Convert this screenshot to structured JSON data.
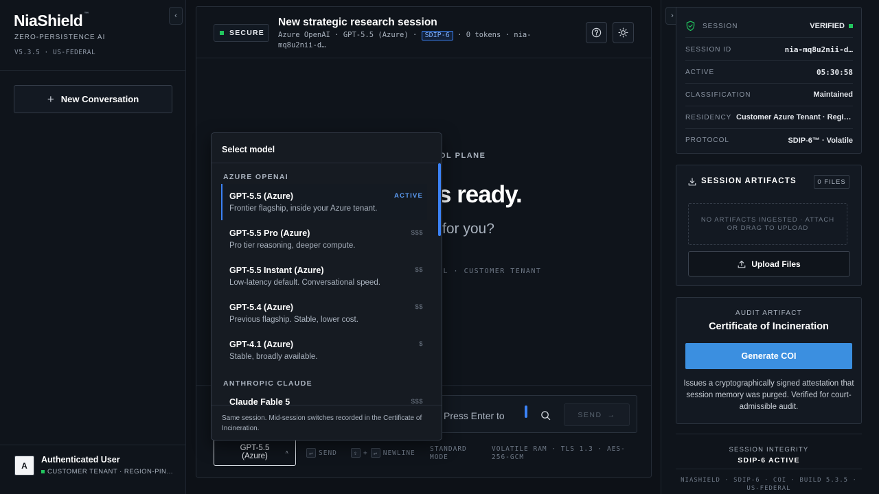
{
  "sidebar": {
    "brand": "NiaShield",
    "brand_mark": "™",
    "tagline": "ZERO-PERSISTENCE AI",
    "version": "V5.3.5 · US-FEDERAL",
    "collapse_glyph": "‹",
    "new_conversation": "New Conversation",
    "user": {
      "initial": "A",
      "name": "Authenticated User",
      "tenant": "CUSTOMER TENANT · REGION-PIN…"
    }
  },
  "header": {
    "secure_badge": "SECURE",
    "title": "New strategic research session",
    "meta_provider": "Azure OpenAI · GPT-5.5 (Azure) ·",
    "meta_tag": "SDIP-6",
    "meta_tokens": "· 0 tokens · nia-",
    "meta_session": "mq8u2nii-d…",
    "help_icon": "help-circle-icon",
    "theme_icon": "sun-icon"
  },
  "hero": {
    "kicker": "OL PLANE",
    "title": "s ready.",
    "subtitle": "for you?",
    "footer": "OL · CUSTOMER TENANT"
  },
  "composer": {
    "placeholder": "Press Enter to",
    "send_label": "SEND",
    "send_arrow": "→"
  },
  "footer_bar": {
    "model_line1": "GPT-5.5",
    "model_line2": "(Azure)",
    "model_chevron": "˄",
    "send_hint": "SEND",
    "plus": "+",
    "newline_hint": "NEWLINE",
    "mode_line1": "STANDARD",
    "mode_line2": "MODE",
    "encryption": "VOLATILE RAM · TLS 1.3 · AES-256-GCM"
  },
  "model_dropdown": {
    "title": "Select model",
    "groups": [
      {
        "label": "AZURE OPENAI"
      },
      {
        "label": "ANTHROPIC CLAUDE"
      }
    ],
    "options": [
      {
        "name": "GPT-5.5 (Azure)",
        "desc": "Frontier flagship, inside your Azure tenant.",
        "tier": "ACTIVE"
      },
      {
        "name": "GPT-5.5 Pro (Azure)",
        "desc": "Pro tier reasoning, deeper compute.",
        "tier": "$$$"
      },
      {
        "name": "GPT-5.5 Instant (Azure)",
        "desc": "Low-latency default. Conversational speed.",
        "tier": "$$"
      },
      {
        "name": "GPT-5.4 (Azure)",
        "desc": "Previous flagship. Stable, lower cost.",
        "tier": "$$"
      },
      {
        "name": "GPT-4.1 (Azure)",
        "desc": "Stable, broadly available.",
        "tier": "$"
      },
      {
        "name": "Claude Fable 5",
        "desc": "",
        "tier": "$$$"
      }
    ],
    "footer": "Same session. Mid-session switches recorded in the Certificate of Incineration."
  },
  "right_panel": {
    "collapse_glyph": "›",
    "session": {
      "label": "SESSION",
      "status": "VERIFIED",
      "rows": [
        {
          "k": "SESSION ID",
          "v": "nia-mq8u2nii-d…"
        },
        {
          "k": "ACTIVE",
          "v": "05:30:58"
        },
        {
          "k": "CLASSIFICATION",
          "v": "Maintained"
        },
        {
          "k": "RESIDENCY",
          "v": "Customer Azure Tenant · Regio…"
        },
        {
          "k": "PROTOCOL",
          "v": "SDIP-6™ · Volatile"
        }
      ]
    },
    "artifacts": {
      "title": "SESSION ARTIFACTS",
      "count": "0 FILES",
      "dropzone": "NO ARTIFACTS INGESTED · ATTACH OR DRAG TO UPLOAD",
      "upload": "Upload Files"
    },
    "coi": {
      "kicker": "AUDIT ARTIFACT",
      "title": "Certificate of Incineration",
      "button": "Generate COI",
      "desc": "Issues a cryptographically signed attestation that session memory was purged. Verified for court-admissible audit."
    },
    "integrity": {
      "label": "SESSION INTEGRITY",
      "value": "SDIP-6 ACTIVE"
    },
    "build": "NIASHIELD · SDIP-6 · COI · BUILD 5.3.5 · US-FEDERAL"
  },
  "colors": {
    "accent": "#3b8fe0",
    "ok": "#22c55e",
    "bg": "#0d1117"
  }
}
